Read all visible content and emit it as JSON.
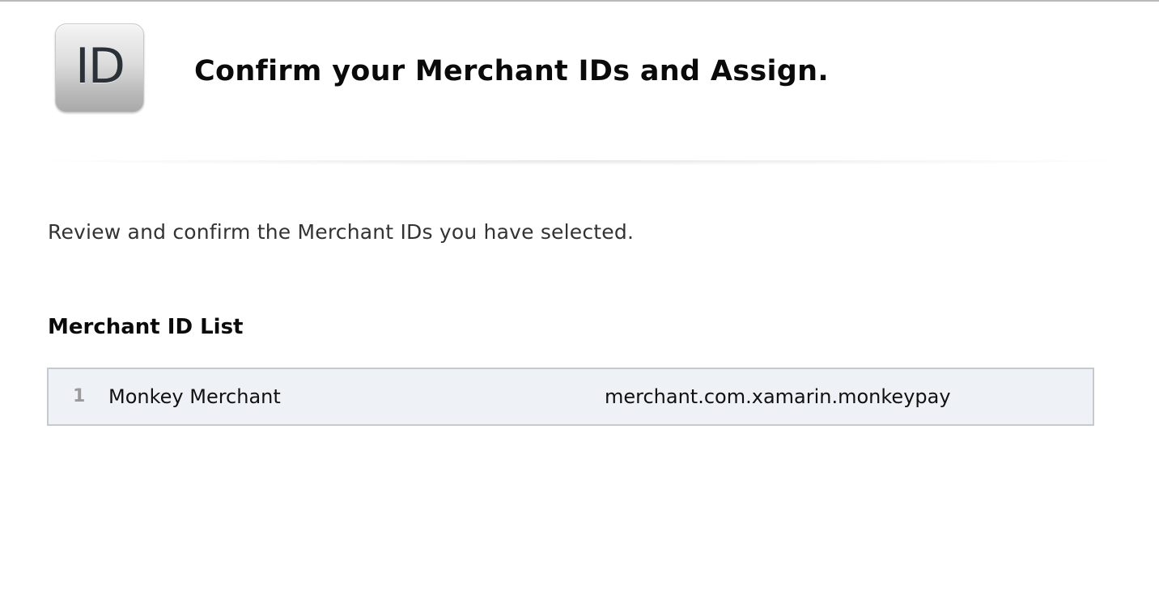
{
  "header": {
    "icon_label": "ID",
    "title": "Confirm your Merchant IDs and Assign."
  },
  "intro": {
    "text": "Review and confirm the Merchant IDs you have selected."
  },
  "merchant_list": {
    "heading": "Merchant ID List",
    "rows": [
      {
        "index": "1",
        "name": "Monkey Merchant",
        "identifier": "merchant.com.xamarin.monkeypay"
      }
    ]
  },
  "colors": {
    "list_background": "#eef1f6",
    "list_border": "#c6c9cd",
    "index_text": "#9a9a9a"
  }
}
